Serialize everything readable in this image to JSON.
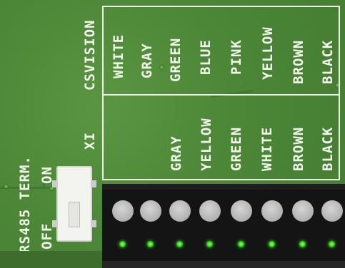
{
  "board": {
    "brand": "CSVISION",
    "connector_label": "XI",
    "rs485_label": "RS485 TERM.",
    "off_label": "OFF",
    "on_label": "ON"
  },
  "wires": {
    "csvision": [
      "WHITE",
      "GRAY",
      "GREEN",
      "BLUE",
      "PINK",
      "YELLOW",
      "BROWN",
      "BLACK"
    ],
    "xi": [
      "GRAY",
      "YELLOW",
      "GREEN",
      "WHITE",
      "BROWN",
      "BLACK"
    ]
  },
  "terminal": {
    "screw_count": 8,
    "led_color": "#24d11d"
  },
  "colors": {
    "pcb": "#4f8a3a",
    "silkscreen": "#f1f5ec",
    "terminal": "#141414"
  }
}
